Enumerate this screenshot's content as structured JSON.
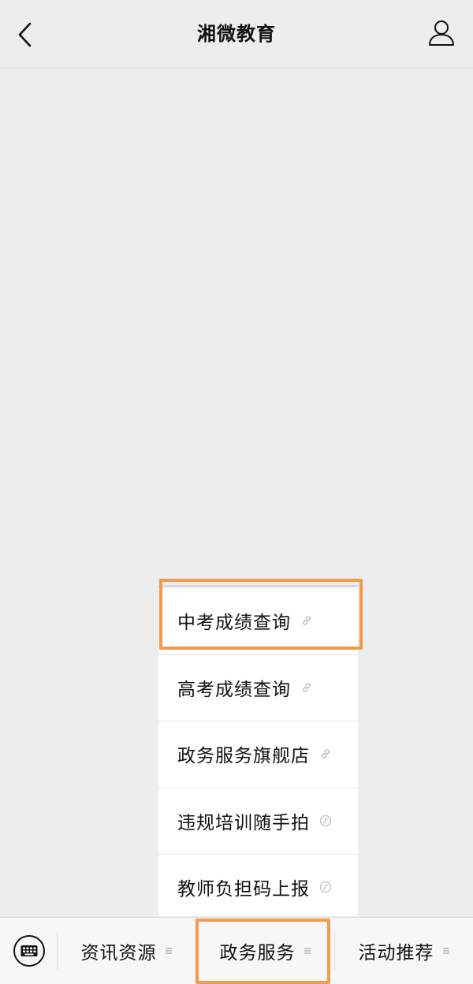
{
  "header": {
    "title": "湘微教育",
    "back_icon": "chevron-left-icon",
    "profile_icon": "person-icon"
  },
  "menu": {
    "items": [
      {
        "label": "中考成绩查询",
        "icon": "link-icon"
      },
      {
        "label": "高考成绩查询",
        "icon": "link-icon"
      },
      {
        "label": "政务服务旗舰店",
        "icon": "link-icon"
      },
      {
        "label": "违规培训随手拍",
        "icon": "mini-program-icon"
      },
      {
        "label": "教师负担码上报",
        "icon": "mini-program-icon"
      }
    ]
  },
  "bottom_bar": {
    "keyboard_icon": "keyboard-icon",
    "tabs": [
      {
        "label": "资讯资源",
        "icon": "menu-lines-icon"
      },
      {
        "label": "政务服务",
        "icon": "menu-lines-icon"
      },
      {
        "label": "活动推荐",
        "icon": "menu-lines-icon"
      }
    ]
  },
  "colors": {
    "background": "#ededed",
    "highlight": "#f39a4c",
    "menu_bg": "#ffffff",
    "bottom_bar_bg": "#f7f7f7"
  }
}
